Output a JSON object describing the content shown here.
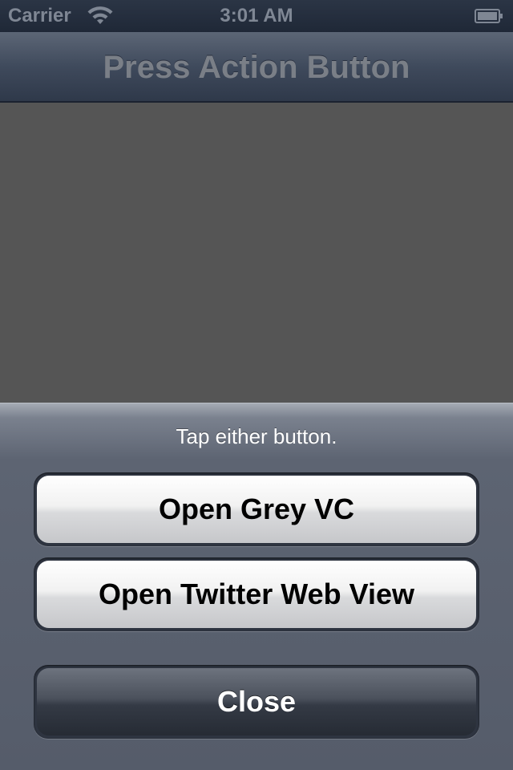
{
  "status_bar": {
    "carrier": "Carrier",
    "time": "3:01 AM",
    "wifi_icon": "wifi-icon",
    "battery_icon": "battery-icon"
  },
  "nav_bar": {
    "title": "Press Action Button"
  },
  "action_sheet": {
    "message": "Tap either button.",
    "buttons": [
      {
        "label": "Open Grey VC"
      },
      {
        "label": "Open Twitter Web View"
      }
    ],
    "close_label": "Close"
  },
  "colors": {
    "status_text": "#7f8794",
    "content_dim": "#555555",
    "sheet_bg": "#5d6472"
  }
}
